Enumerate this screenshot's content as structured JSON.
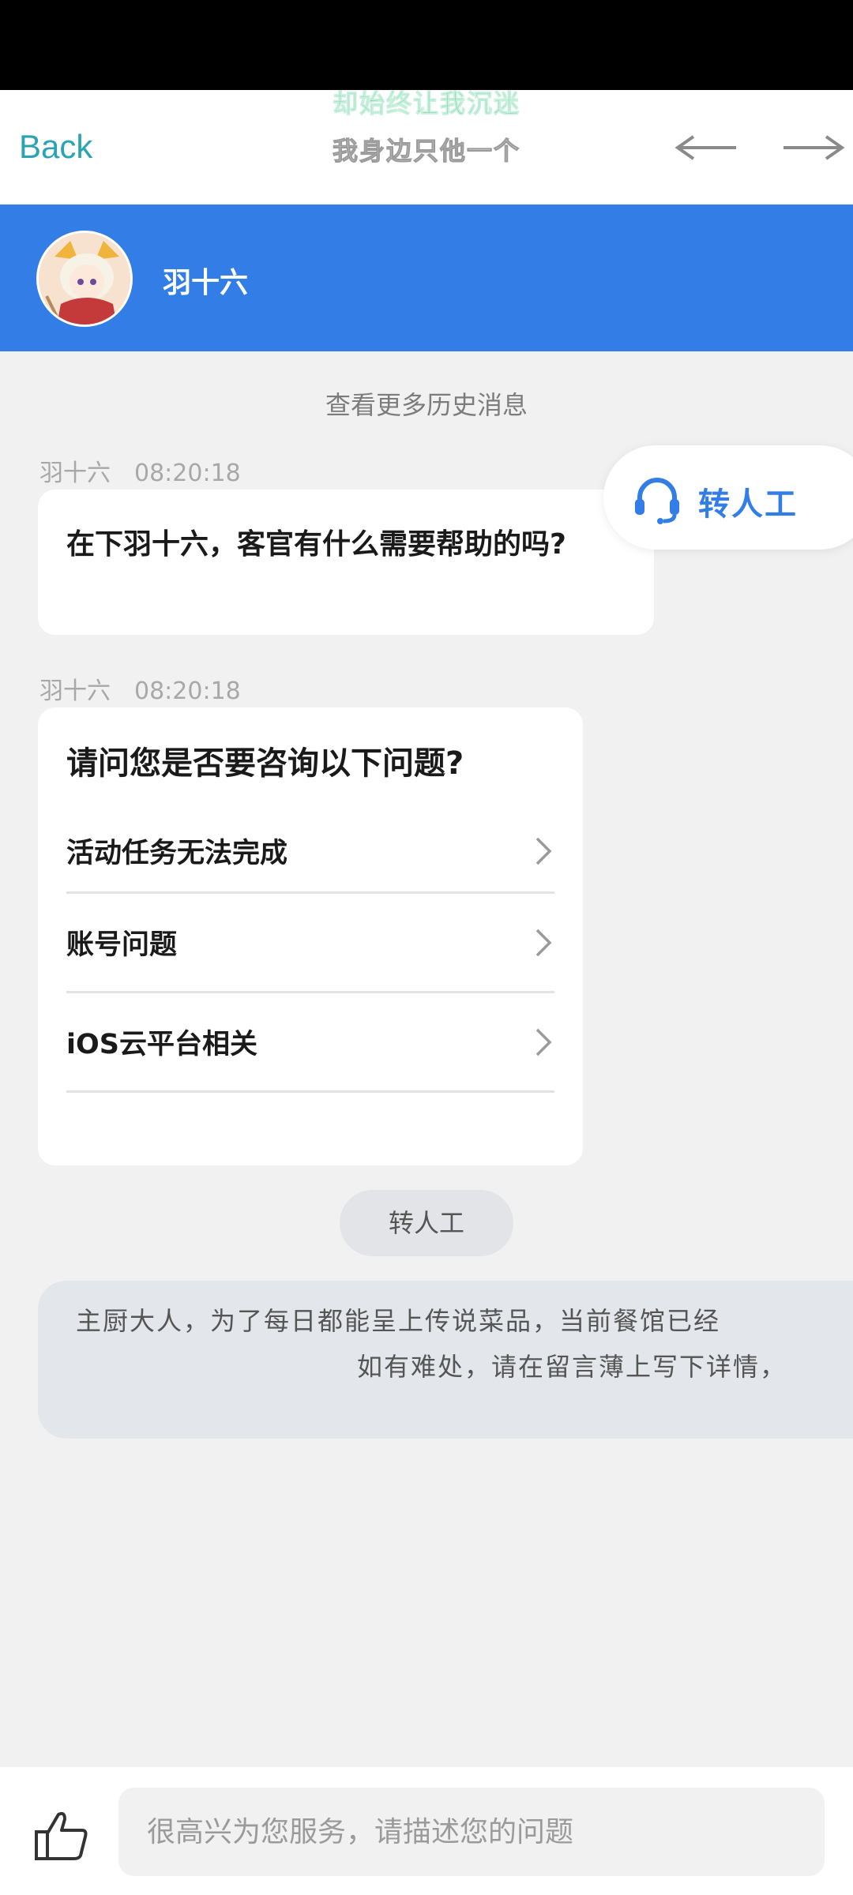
{
  "top_nav": {
    "back_label": "Back",
    "lyric_line_1": "却始终让我沉迷",
    "lyric_line_2": "我身边只他一个"
  },
  "chat_header": {
    "agent_name": "羽十六"
  },
  "history_link": "查看更多历史消息",
  "messages": [
    {
      "sender": "羽十六",
      "time": "08:20:18",
      "text": "在下羽十六，客官有什么需要帮助的吗?"
    },
    {
      "sender": "羽十六",
      "time": "08:20:18",
      "question": "请问您是否要咨询以下问题?",
      "options": [
        {
          "label": "活动任务无法完成"
        },
        {
          "label": "账号问题"
        },
        {
          "label": "iOS云平台相关"
        }
      ]
    }
  ],
  "float_agent_label": "转人工",
  "transfer_button_label": "转人工",
  "notice": {
    "line_1": "主厨大人，为了每日都能呈上传说菜品，当前餐馆已经",
    "line_2": "如有难处，请在留言薄上写下详情，"
  },
  "input": {
    "placeholder": "很高兴为您服务，请描述您的问题"
  },
  "icons": {
    "back": "back-text",
    "prev": "arrow-left-icon",
    "next": "arrow-right-icon",
    "headset": "headset-icon",
    "chevron": "chevron-right-icon",
    "like": "thumbs-up-icon"
  },
  "colors": {
    "header_blue": "#327ee6",
    "back_teal": "#2aa4b4",
    "page_bg": "#f1f1f1"
  }
}
